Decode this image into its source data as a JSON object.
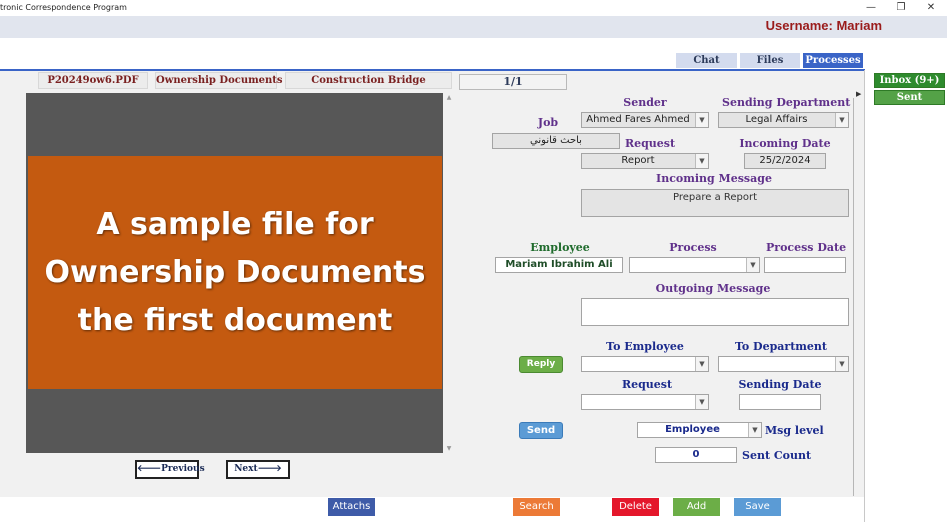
{
  "window": {
    "title": "tronic Correspondence Program",
    "minimize_glyph": "—",
    "maximize_glyph": "❐",
    "close_glyph": "✕"
  },
  "header": {
    "username_label": "Username: Mariam"
  },
  "top_tabs": {
    "chat": "Chat",
    "files": "Files",
    "processes": "Processes"
  },
  "sidebar": {
    "inbox": "Inbox (9+)",
    "sent": "Sent"
  },
  "doc_tabs": {
    "file_name": "P20249ow6.PDF",
    "category": "Ownership Documents",
    "project": "Construction Bridge"
  },
  "viewer": {
    "page_indicator": "1/1",
    "lines": [
      "A sample file for",
      "Ownership Documents",
      "the first document"
    ],
    "previous_label": "Previous",
    "next_label": "Next",
    "prev_arrow": "🡐",
    "next_arrow": "🡒"
  },
  "form": {
    "sender_label": "Sender",
    "sender_value": "Ahmed Fares Ahmed",
    "sending_dept_label": "Sending Department",
    "sending_dept_value": "Legal Affairs",
    "job_label": "Job",
    "job_value": "باحث قانوني",
    "request_label": "Request",
    "request_value": "Report",
    "incoming_date_label": "Incoming Date",
    "incoming_date_value": "25/2/2024",
    "incoming_message_label": "Incoming Message",
    "incoming_message_value": "Prepare a Report",
    "employee_label": "Employee",
    "employee_value": "Mariam Ibrahim Ali",
    "process_label": "Process",
    "process_value": "",
    "process_date_label": "Process Date",
    "process_date_value": "",
    "outgoing_message_label": "Outgoing Message",
    "outgoing_message_value": "",
    "reply_label": "Reply",
    "to_employee_label": "To Employee",
    "to_department_label": "To Department",
    "request2_label": "Request",
    "sending_date_label": "Sending Date",
    "send_label": "Send",
    "msg_level_value": "Employee",
    "msg_level_label": "Msg level",
    "sent_count_value": "0",
    "sent_count_label": "Sent Count",
    "dropdown_glyph": "▼"
  },
  "actions": {
    "attachs": "Attachs",
    "search": "Search",
    "delete": "Delete",
    "add": "Add",
    "save": "Save"
  },
  "colors": {
    "accent_blue": "#3a64c7",
    "username_red": "#9a1b1b",
    "inbox_green": "#2e8b2e",
    "document_orange": "#c45a10",
    "delete_red": "#e4172b",
    "search_orange": "#ec7a37",
    "add_green": "#6cae47",
    "save_blue": "#5b9bd5",
    "attachs_blue": "#3e5ba8"
  }
}
